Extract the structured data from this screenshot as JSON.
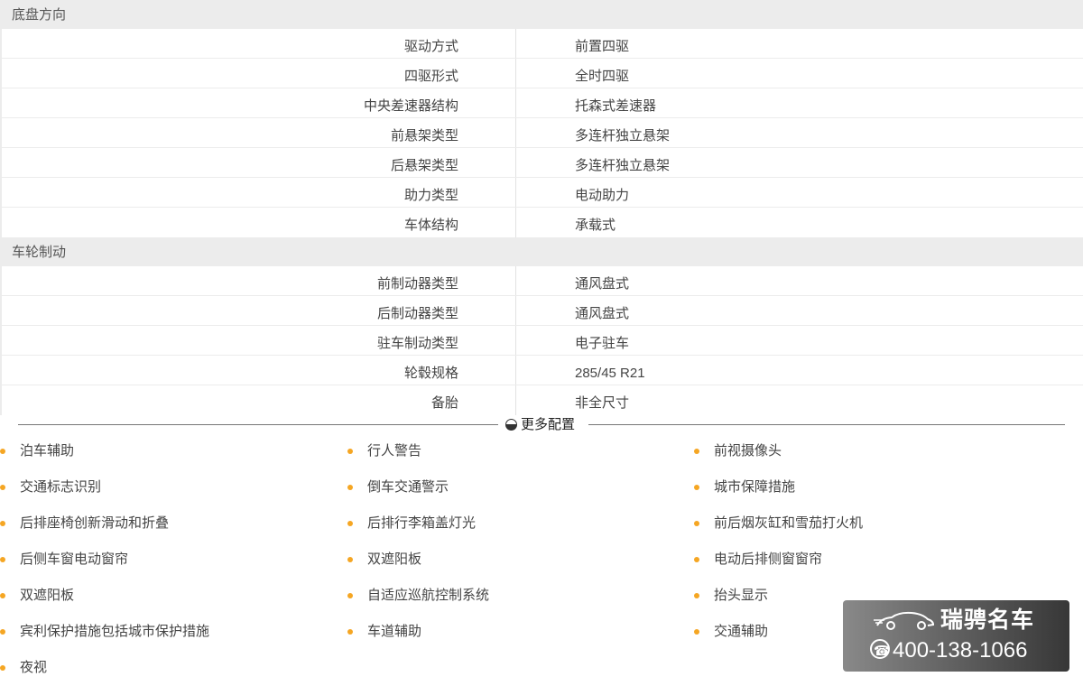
{
  "sections": [
    {
      "title": "底盘方向",
      "rows": [
        {
          "label": "驱动方式",
          "value": "前置四驱"
        },
        {
          "label": "四驱形式",
          "value": "全时四驱"
        },
        {
          "label": "中央差速器结构",
          "value": "托森式差速器"
        },
        {
          "label": "前悬架类型",
          "value": "多连杆独立悬架"
        },
        {
          "label": "后悬架类型",
          "value": "多连杆独立悬架"
        },
        {
          "label": "助力类型",
          "value": "电动助力"
        },
        {
          "label": "车体结构",
          "value": "承载式"
        }
      ]
    },
    {
      "title": "车轮制动",
      "rows": [
        {
          "label": "前制动器类型",
          "value": "通风盘式"
        },
        {
          "label": "后制动器类型",
          "value": "通风盘式"
        },
        {
          "label": "驻车制动类型",
          "value": "电子驻车"
        },
        {
          "label": "轮毂规格",
          "value": "285/45 R21"
        },
        {
          "label": "备胎",
          "value": "非全尺寸"
        }
      ]
    }
  ],
  "more_button": {
    "label": "更多配置",
    "icon": "half-circle-icon"
  },
  "features": [
    "泊车辅助",
    "行人警告",
    "前视摄像头",
    "交通标志识别",
    "倒车交通警示",
    "城市保障措施",
    "后排座椅创新滑动和折叠",
    "后排行李箱盖灯光",
    "前后烟灰缸和雪茄打火机",
    "后侧车窗电动窗帘",
    "双遮阳板",
    "电动后排侧窗窗帘",
    "双遮阳板",
    "自适应巡航控制系统",
    "抬头显示",
    "宾利保护措施包括城市保护措施",
    "车道辅助",
    "交通辅助",
    "夜视"
  ],
  "colors": {
    "bullet": "#f5a623",
    "section_bg": "#ececec"
  },
  "watermark": {
    "name": "瑞骋名车",
    "phone": "400-138-1066",
    "icon": "car-icon"
  }
}
